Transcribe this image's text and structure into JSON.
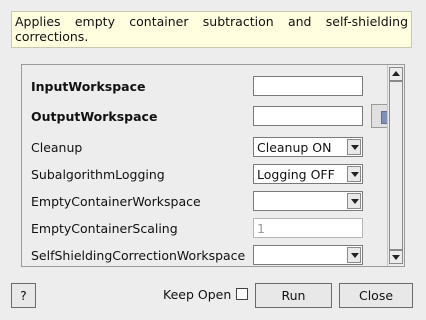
{
  "description": "Applies empty container subtraction and self-shielding corrections.",
  "properties": [
    {
      "label": "InputWorkspace",
      "bold": true,
      "type": "text",
      "value": ""
    },
    {
      "label": "OutputWorkspace",
      "bold": true,
      "type": "text",
      "value": "",
      "has_browse": true
    },
    {
      "label": "Cleanup",
      "bold": false,
      "type": "combo",
      "value": "Cleanup ON"
    },
    {
      "label": "SubalgorithmLogging",
      "bold": false,
      "type": "combo",
      "value": "Logging OFF"
    },
    {
      "label": "EmptyContainerWorkspace",
      "bold": false,
      "type": "combo",
      "value": ""
    },
    {
      "label": "EmptyContainerScaling",
      "bold": false,
      "type": "text-disabled",
      "value": "1"
    },
    {
      "label": "SelfShieldingCorrectionWorkspace",
      "bold": false,
      "type": "combo",
      "value": ""
    }
  ],
  "buttons": {
    "help": "?",
    "keep_open": "Keep Open",
    "run": "Run",
    "close": "Close"
  },
  "keep_open_checked": false
}
